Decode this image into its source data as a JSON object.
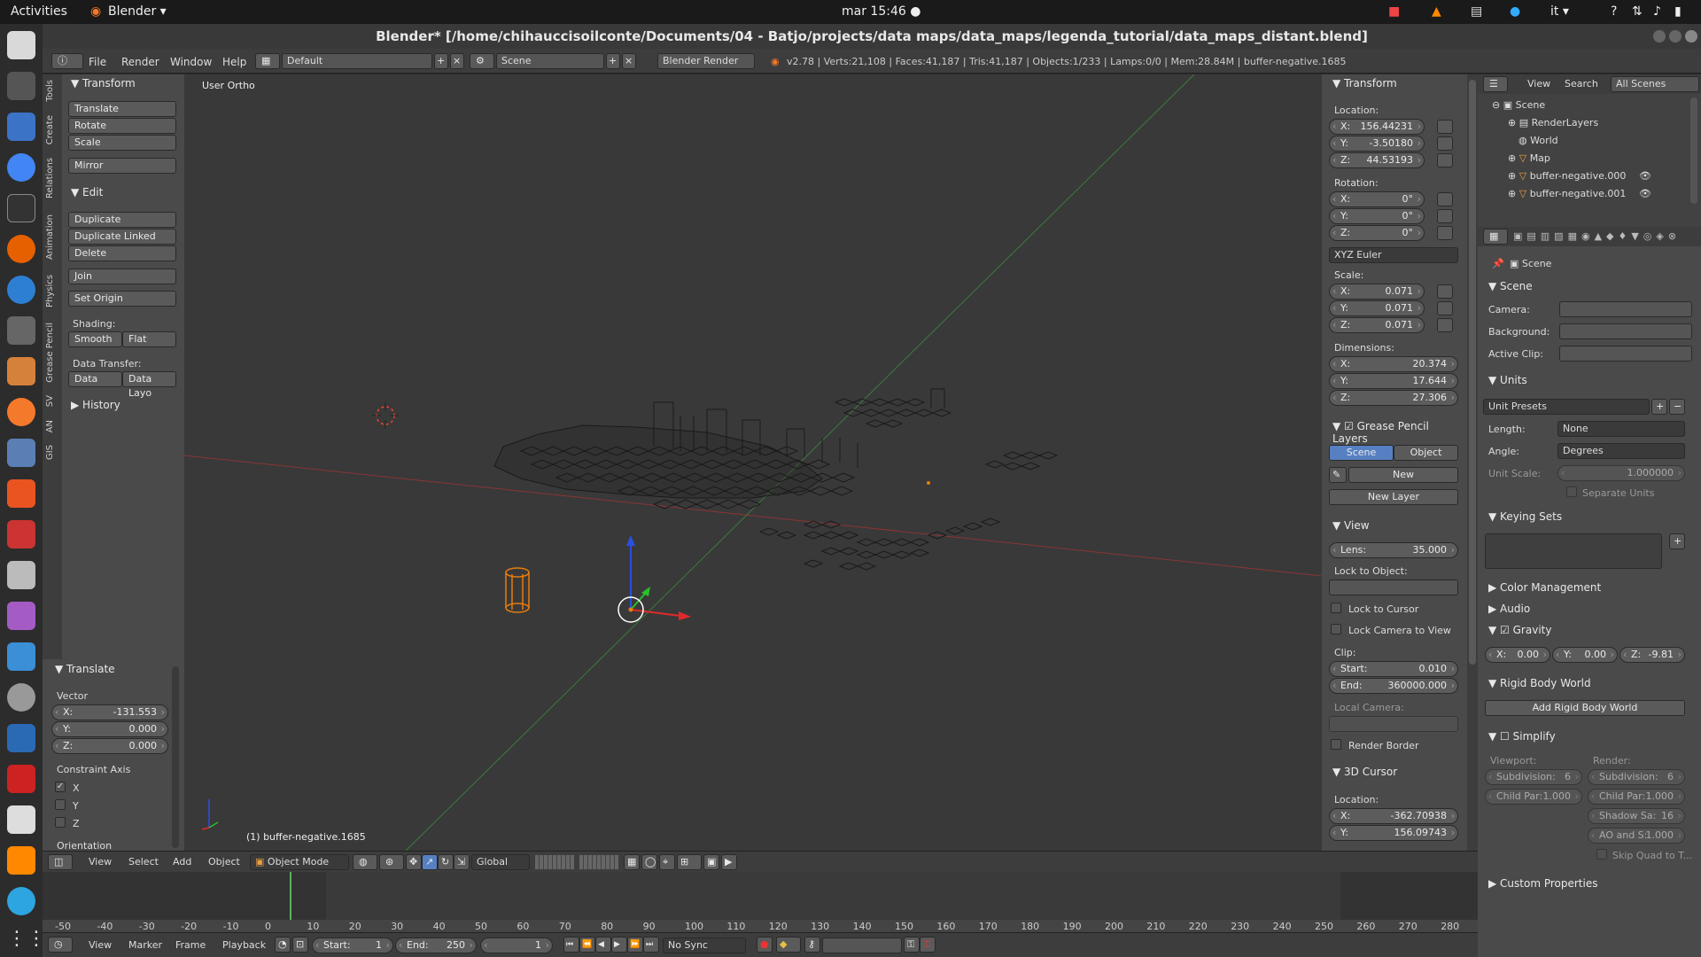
{
  "topbar": {
    "activities": "Activities",
    "app_name": "Blender ▾",
    "clock": "mar 15:46 ●",
    "lang": "it ▾"
  },
  "window": {
    "title": "Blender* [/home/chihauccisoilconte/Documents/04 - Batjo/projects/data maps/data_maps/legenda_tutorial/data_maps_distant.blend]"
  },
  "infobar": {
    "menus": [
      "File",
      "Render",
      "Window",
      "Help"
    ],
    "layout": "Default",
    "scene": "Scene",
    "engine": "Blender Render",
    "stats": "v2.78 | Verts:21,108 | Faces:41,187 | Tris:41,187 | Objects:1/233 | Lamps:0/0 | Mem:28.84M | buffer-negative.1685"
  },
  "lefttabs": [
    "Tools",
    "Create",
    "Relations",
    "Animation",
    "Physics",
    "Grease Pencil",
    "SV",
    "AN",
    "GIS"
  ],
  "toolshelf": {
    "transform_header": "Transform",
    "translate": "Translate",
    "rotate": "Rotate",
    "scale": "Scale",
    "mirror": "Mirror",
    "edit_header": "Edit",
    "duplicate": "Duplicate",
    "duplicate_linked": "Duplicate Linked",
    "delete": "Delete",
    "join": "Join",
    "set_origin": "Set Origin",
    "shading_label": "Shading:",
    "smooth": "Smooth",
    "flat": "Flat",
    "data_transfer_label": "Data Transfer:",
    "data": "Data",
    "data_layout": "Data Layo",
    "history_header": "History"
  },
  "redo": {
    "header": "Translate",
    "vector_label": "Vector",
    "x": {
      "k": "X:",
      "v": "-131.553"
    },
    "y": {
      "k": "Y:",
      "v": "0.000"
    },
    "z": {
      "k": "Z:",
      "v": "0.000"
    },
    "constraint_label": "Constraint Axis",
    "cx": "X",
    "cy": "Y",
    "cz": "Z",
    "orientation": "Orientation"
  },
  "viewport": {
    "view_name": "User Ortho",
    "object_label": "(1) buffer-negative.1685"
  },
  "npanel": {
    "transform_header": "Transform",
    "location_label": "Location:",
    "loc": [
      {
        "k": "X:",
        "v": "156.44231"
      },
      {
        "k": "Y:",
        "v": "-3.50180"
      },
      {
        "k": "Z:",
        "v": "44.53193"
      }
    ],
    "rotation_label": "Rotation:",
    "rot": [
      {
        "k": "X:",
        "v": "0°"
      },
      {
        "k": "Y:",
        "v": "0°"
      },
      {
        "k": "Z:",
        "v": "0°"
      }
    ],
    "rotation_mode": "XYZ Euler",
    "scale_label": "Scale:",
    "scale": [
      {
        "k": "X:",
        "v": "0.071"
      },
      {
        "k": "Y:",
        "v": "0.071"
      },
      {
        "k": "Z:",
        "v": "0.071"
      }
    ],
    "dimensions_label": "Dimensions:",
    "dims": [
      {
        "k": "X:",
        "v": "20.374"
      },
      {
        "k": "Y:",
        "v": "17.644"
      },
      {
        "k": "Z:",
        "v": "27.306"
      }
    ],
    "gp_header": "Grease Pencil Layers",
    "gp_scene": "Scene",
    "gp_object": "Object",
    "gp_new": "New",
    "gp_new_layer": "New Layer",
    "view_header": "View",
    "lens": {
      "k": "Lens:",
      "v": "35.000"
    },
    "lock_object_label": "Lock to Object:",
    "lock_cursor": "Lock to Cursor",
    "lock_camera": "Lock Camera to View",
    "clip_label": "Clip:",
    "clip_start": {
      "k": "Start:",
      "v": "0.010"
    },
    "clip_end": {
      "k": "End:",
      "v": "360000.000"
    },
    "local_camera_label": "Local Camera:",
    "render_border": "Render Border",
    "cursor_header": "3D Cursor",
    "cursor_location_label": "Location:",
    "cursor": [
      {
        "k": "X:",
        "v": "-362.70938"
      },
      {
        "k": "Y:",
        "v": "156.09743"
      }
    ]
  },
  "outliner": {
    "view": "View",
    "search": "Search",
    "filter": "All Scenes",
    "items": [
      "Scene",
      "RenderLayers",
      "World",
      "Map",
      "buffer-negative.000",
      "buffer-negative.001"
    ]
  },
  "props": {
    "context": "Scene",
    "scene_header": "Scene",
    "camera_label": "Camera:",
    "background_label": "Background:",
    "active_clip_label": "Active Clip:",
    "units_header": "Units",
    "unit_presets": "Unit Presets",
    "length_label": "Length:",
    "length_value": "None",
    "angle_label": "Angle:",
    "angle_value": "Degrees",
    "unit_scale_label": "Unit Scale:",
    "unit_scale_value": "1.000000",
    "separate_units": "Separate Units",
    "keying_header": "Keying Sets",
    "color_mgmt": "Color Management",
    "audio": "Audio",
    "gravity": "Gravity",
    "gx": {
      "k": "X:",
      "v": "0.00"
    },
    "gy": {
      "k": "Y:",
      "v": "0.00"
    },
    "gz": {
      "k": "Z:",
      "v": "-9.81"
    },
    "rigid_header": "Rigid Body World",
    "add_rigid": "Add Rigid Body World",
    "simplify": "Simplify",
    "viewport_label": "Viewport:",
    "render_label": "Render:",
    "subdiv_v": {
      "k": "Subdivision:",
      "v": "6"
    },
    "subdiv_r": {
      "k": "Subdivision:",
      "v": "6"
    },
    "childpar_v": {
      "k": "Child Par:",
      "v": "1.000"
    },
    "childpar_r": {
      "k": "Child Par:",
      "v": "1.000"
    },
    "shadow": {
      "k": "Shadow Sa:",
      "v": "16"
    },
    "ao": {
      "k": "AO and S:",
      "v": "1.000"
    },
    "skip_quad": "Skip Quad to T...",
    "custom_props": "Custom Properties"
  },
  "vphdr": {
    "menus": [
      "View",
      "Select",
      "Add",
      "Object"
    ],
    "mode": "Object Mode",
    "orientation": "Global"
  },
  "timeline": {
    "ticks": [
      "-50",
      "-40",
      "-30",
      "-20",
      "-10",
      "0",
      "10",
      "20",
      "30",
      "40",
      "50",
      "60",
      "70",
      "80",
      "90",
      "100",
      "110",
      "120",
      "130",
      "140",
      "150",
      "160",
      "170",
      "180",
      "190",
      "200",
      "210",
      "220",
      "230",
      "240",
      "250",
      "260",
      "270",
      "280"
    ],
    "menus": [
      "View",
      "Marker",
      "Frame",
      "Playback"
    ],
    "start": {
      "k": "Start:",
      "v": "1"
    },
    "end": {
      "k": "End:",
      "v": "250"
    },
    "current": "1",
    "sync": "No Sync"
  }
}
